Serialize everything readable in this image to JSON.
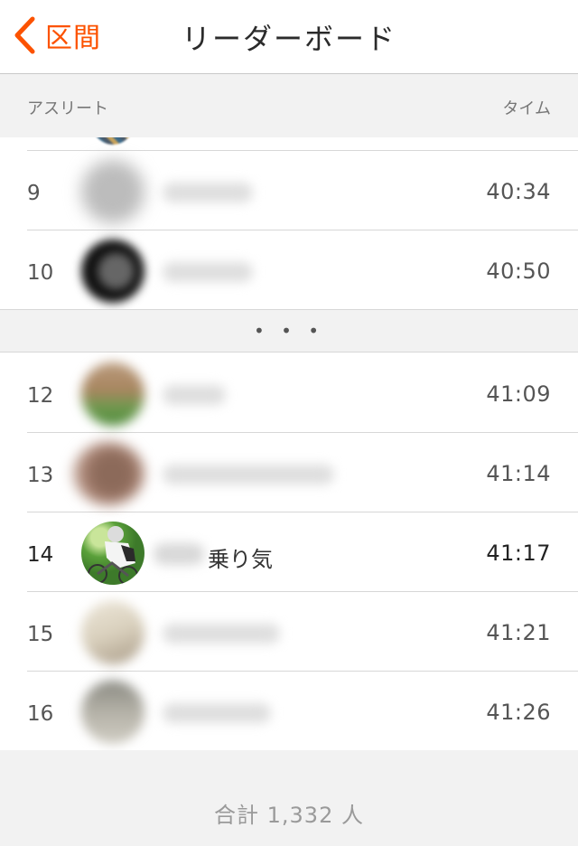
{
  "nav": {
    "back_label": "区間",
    "title": "リーダーボード"
  },
  "columns": {
    "athlete": "アスリート",
    "time": "タイム"
  },
  "colors": {
    "accent": "#fc5200"
  },
  "upper_rows": [
    {
      "rank": "9",
      "time": "40:34"
    },
    {
      "rank": "10",
      "time": "40:50"
    }
  ],
  "gap": {
    "label": "• • •"
  },
  "lower_rows": [
    {
      "rank": "12",
      "time": "41:09"
    },
    {
      "rank": "13",
      "time": "41:14"
    },
    {
      "rank": "14",
      "name": "乗り気",
      "time": "41:17"
    },
    {
      "rank": "15",
      "time": "41:21"
    },
    {
      "rank": "16",
      "time": "41:26"
    }
  ],
  "footer": {
    "total": "合計 1,332 人"
  }
}
